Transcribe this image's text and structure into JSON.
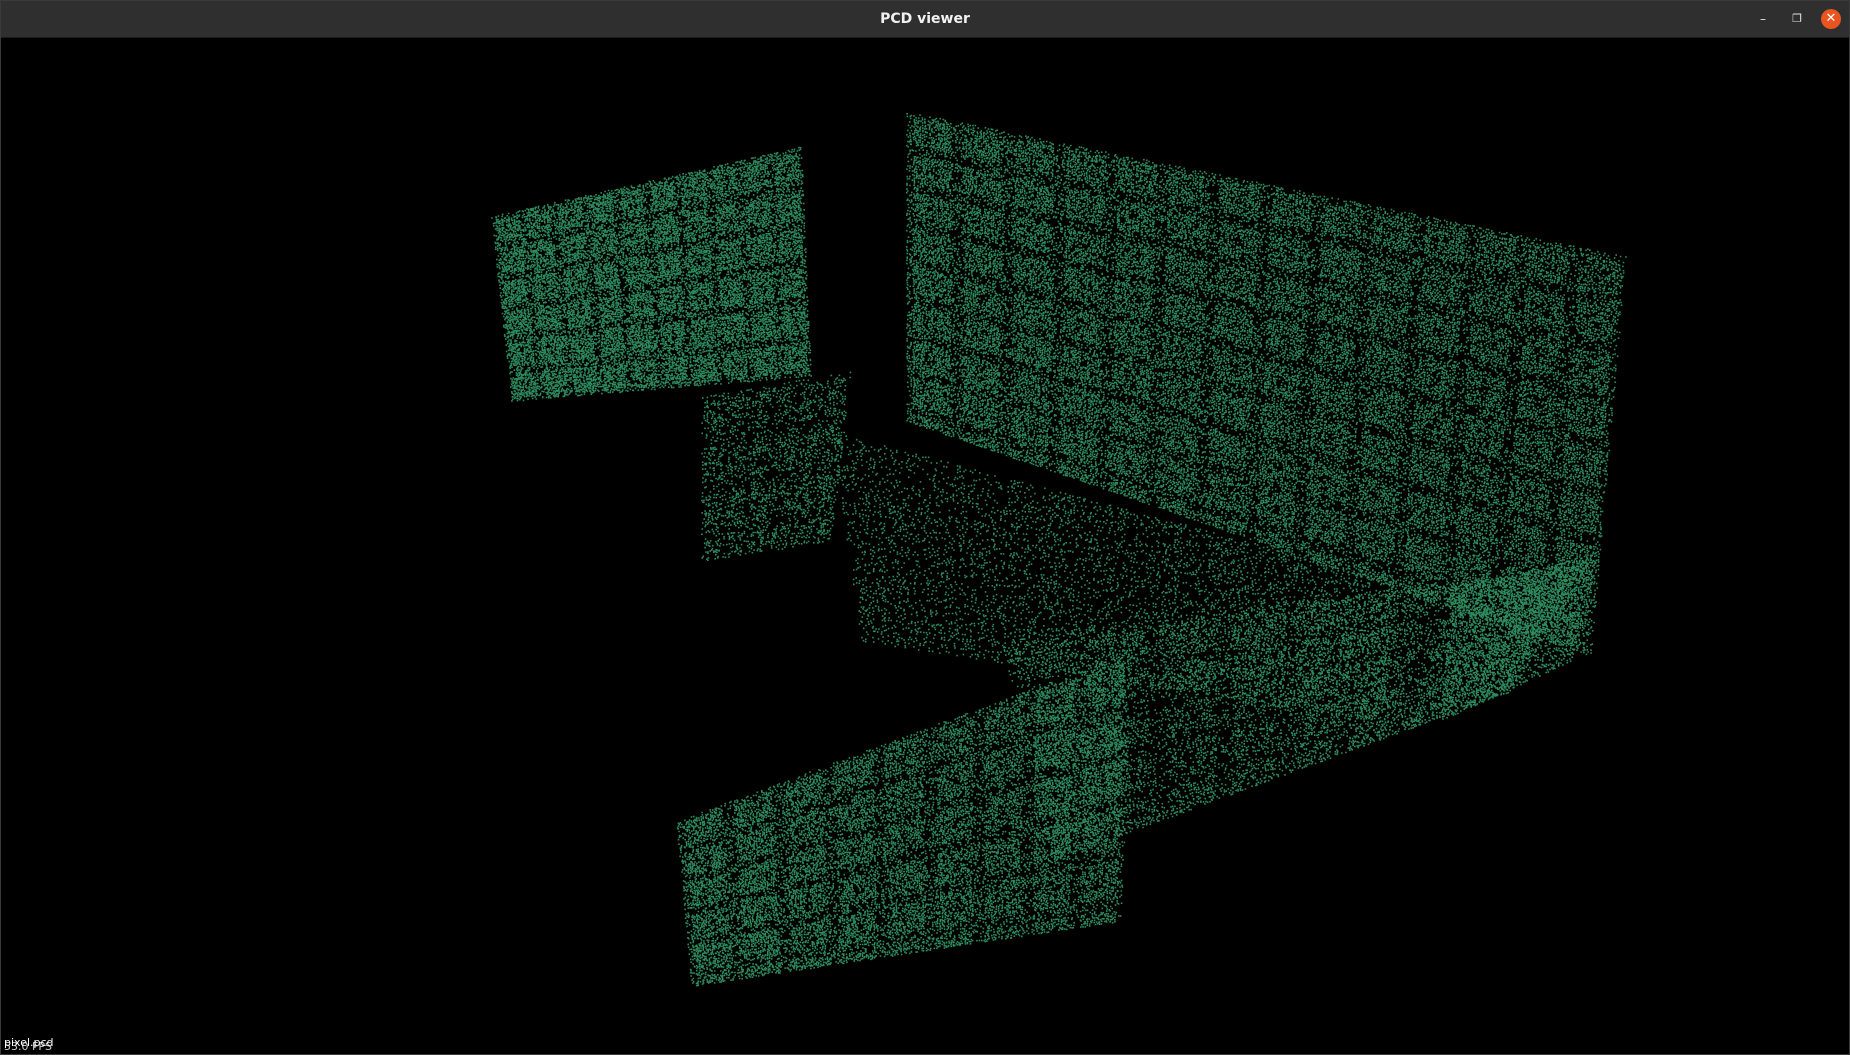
{
  "window": {
    "title": "PCD viewer",
    "minimize_glyph": "–",
    "maximize_glyph": "❐",
    "close_glyph": "✕"
  },
  "viewer": {
    "background_color": "#000000",
    "point_color": "#2e8b5e",
    "filename": "pixel.pcd",
    "fps": "53.0 FPS"
  },
  "icons": {
    "minimize": "minimize-icon",
    "maximize": "maximize-icon",
    "close": "close-icon"
  }
}
